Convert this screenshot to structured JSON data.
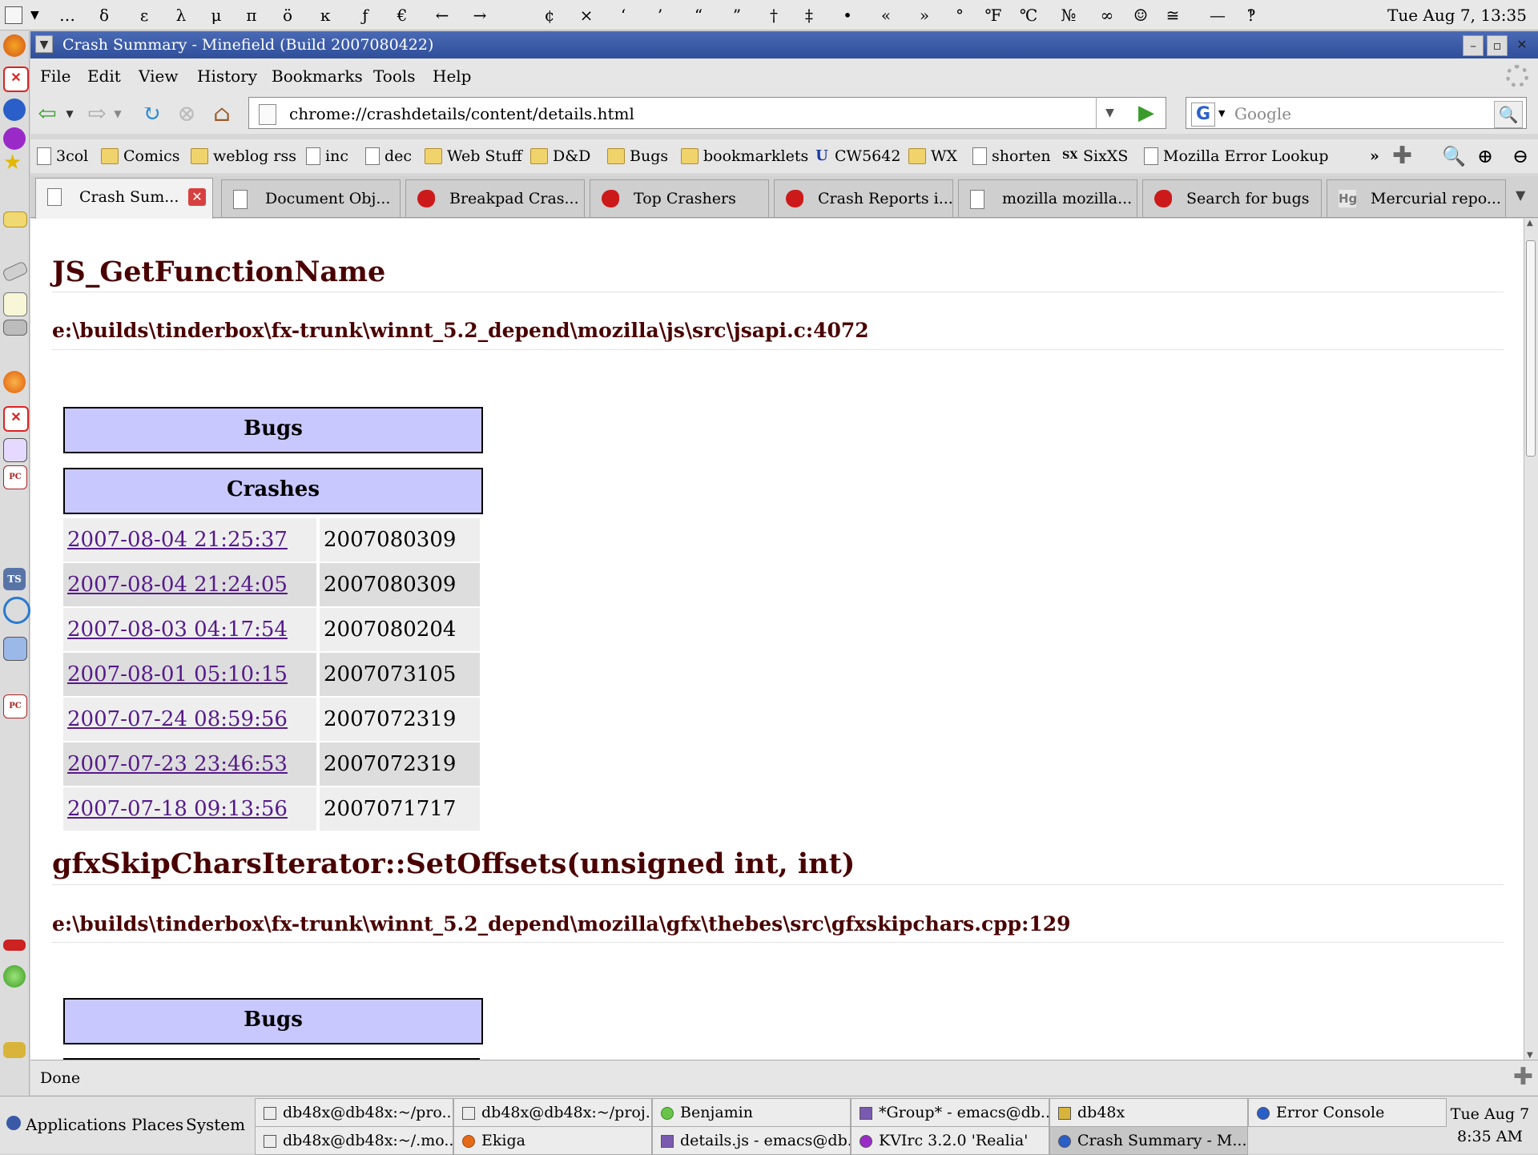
{
  "top_panel": {
    "chars": [
      "…",
      "δ",
      "ε",
      "λ",
      "μ",
      "π",
      "ö",
      "ĸ",
      "ƒ",
      "€",
      "←",
      "→",
      "¢",
      "×",
      "‘",
      "’",
      "“",
      "”",
      "†",
      "‡",
      "•",
      "«",
      "»",
      "°",
      "℉",
      "℃",
      "№",
      "∞",
      "☺",
      "≅",
      "—",
      "‽"
    ],
    "clock": "Tue Aug 7, 13:35"
  },
  "window": {
    "title": "Crash Summary - Minefield (Build 2007080422)",
    "minimize": "–",
    "maximize": "▫",
    "close": "✕"
  },
  "menubar": {
    "items": [
      "File",
      "Edit",
      "View",
      "History",
      "Bookmarks",
      "Tools",
      "Help"
    ]
  },
  "navbar": {
    "url": "chrome://crashdetails/content/details.html",
    "search_placeholder": "Google",
    "search_engine_letter": "G"
  },
  "bookmarks": {
    "items": [
      "3col",
      "Comics",
      "weblog rss",
      "inc",
      "dec",
      "Web Stuff",
      "D&D",
      "Bugs",
      "bookmarklets",
      "CW5642",
      "WX",
      "shorten",
      "SixXS",
      "Mozilla Error Lookup"
    ],
    "overflow": "»"
  },
  "tabs": [
    {
      "label": "Crash Sum...",
      "icon": "page-icon"
    },
    {
      "label": "Document Obj...",
      "icon": "page-icon"
    },
    {
      "label": "Breakpad Cras...",
      "icon": "bug-icon"
    },
    {
      "label": "Top Crashers",
      "icon": "bug-icon"
    },
    {
      "label": "Crash Reports i...",
      "icon": "bug-icon"
    },
    {
      "label": "mozilla mozilla...",
      "icon": "page-icon"
    },
    {
      "label": "Search for bugs",
      "icon": "bug-icon"
    },
    {
      "label": "Mercurial repo...",
      "icon": "hg-icon",
      "icon_text": "Hg"
    }
  ],
  "content": {
    "sections": [
      {
        "function": "JS_GetFunctionName",
        "file": "e:\\builds\\tinderbox\\fx-trunk\\winnt_5.2_depend\\mozilla\\js\\src\\jsapi.c:4072",
        "bugs_header": "Bugs",
        "crashes_header": "Crashes",
        "crashes": [
          {
            "date": "2007-08-04 21:25:37",
            "build": "2007080309"
          },
          {
            "date": "2007-08-04 21:24:05",
            "build": "2007080309"
          },
          {
            "date": "2007-08-03 04:17:54",
            "build": "2007080204"
          },
          {
            "date": "2007-08-01 05:10:15",
            "build": "2007073105"
          },
          {
            "date": "2007-07-24 08:59:56",
            "build": "2007072319"
          },
          {
            "date": "2007-07-23 23:46:53",
            "build": "2007072319"
          },
          {
            "date": "2007-07-18 09:13:56",
            "build": "2007071717"
          }
        ]
      },
      {
        "function": "gfxSkipCharsIterator::SetOffsets(unsigned int, int)",
        "file": "e:\\builds\\tinderbox\\fx-trunk\\winnt_5.2_depend\\mozilla\\gfx\\thebes\\src\\gfxskipchars.cpp:129",
        "bugs_header": "Bugs"
      }
    ]
  },
  "statusbar": {
    "text": "Done"
  },
  "bottom_panel": {
    "menus": [
      "Applications",
      "Places",
      "System"
    ],
    "tasks_row1": [
      "db48x@db48x:~/pro...",
      "db48x@db48x:~/proj...",
      "Benjamin",
      "*Group* - emacs@db...",
      "db48x",
      "Error Console"
    ],
    "tasks_row2": [
      "db48x@db48x:~/.mo...",
      "Ekiga",
      "details.js - emacs@db...",
      "KVIrc 3.2.0 'Realia'",
      "Crash Summary - M..."
    ],
    "clock_line1": "Tue Aug 7",
    "clock_line2": "8:35 AM"
  },
  "colors": {
    "heading": "#4a0000",
    "header_fill": "#c8c8ff",
    "link": "#551a8b",
    "title_bar": "#3a5aa8"
  }
}
